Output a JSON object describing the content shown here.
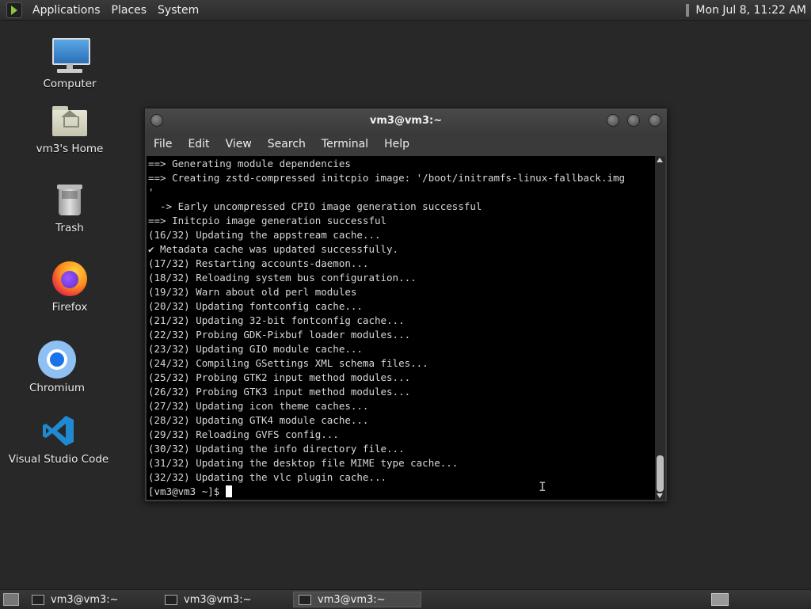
{
  "top_panel": {
    "menus": [
      "Applications",
      "Places",
      "System"
    ],
    "clock": "Mon Jul  8, 11:22 AM"
  },
  "desktop": {
    "icons": [
      {
        "label": "Computer",
        "icon": "computer-icon"
      },
      {
        "label": "vm3's Home",
        "icon": "home-folder-icon"
      },
      {
        "label": "Trash",
        "icon": "trash-icon"
      },
      {
        "label": "Firefox",
        "icon": "firefox-icon"
      },
      {
        "label": "Chromium",
        "icon": "chromium-icon"
      },
      {
        "label": "Visual Studio Code",
        "icon": "vscode-icon"
      }
    ]
  },
  "terminal": {
    "title": "vm3@vm3:~",
    "menu": [
      "File",
      "Edit",
      "View",
      "Search",
      "Terminal",
      "Help"
    ],
    "lines": [
      "==> Generating module dependencies",
      "==> Creating zstd-compressed initcpio image: '/boot/initramfs-linux-fallback.img",
      "'",
      "  -> Early uncompressed CPIO image generation successful",
      "==> Initcpio image generation successful",
      "(16/32) Updating the appstream cache...",
      "✔ Metadata cache was updated successfully.",
      "(17/32) Restarting accounts-daemon...",
      "(18/32) Reloading system bus configuration...",
      "(19/32) Warn about old perl modules",
      "(20/32) Updating fontconfig cache...",
      "(21/32) Updating 32-bit fontconfig cache...",
      "(22/32) Probing GDK-Pixbuf loader modules...",
      "(23/32) Updating GIO module cache...",
      "(24/32) Compiling GSettings XML schema files...",
      "(25/32) Probing GTK2 input method modules...",
      "(26/32) Probing GTK3 input method modules...",
      "(27/32) Updating icon theme caches...",
      "(28/32) Updating GTK4 module cache...",
      "(29/32) Reloading GVFS config...",
      "(30/32) Updating the info directory file...",
      "(31/32) Updating the desktop file MIME type cache...",
      "(32/32) Updating the vlc plugin cache..."
    ],
    "prompt": "[vm3@vm3 ~]$ "
  },
  "taskbar": {
    "tasks": [
      {
        "label": "vm3@vm3:~",
        "active": false
      },
      {
        "label": "vm3@vm3:~",
        "active": false
      },
      {
        "label": "vm3@vm3:~",
        "active": true
      }
    ]
  }
}
